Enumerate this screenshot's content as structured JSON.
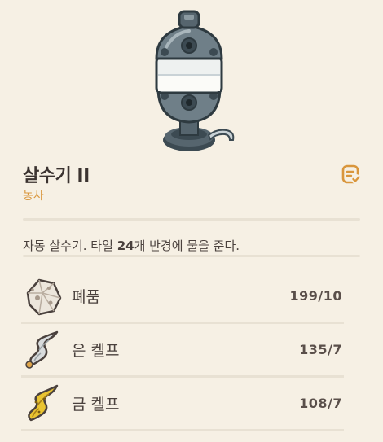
{
  "item": {
    "title": "살수기 II",
    "category": "농사",
    "description_prefix": "자동 살수기. 타일 ",
    "description_number": "24",
    "description_suffix": "개 반경에 물을 준다."
  },
  "ingredients": [
    {
      "name": "폐품",
      "count": "199/10",
      "icon": "refined-quartz-icon"
    },
    {
      "name": "은 켈프",
      "count": "135/7",
      "icon": "silver-kelp-icon"
    },
    {
      "name": "금 켈프",
      "count": "108/7",
      "icon": "gold-kelp-icon"
    }
  ],
  "colors": {
    "background": "#f6f0e4",
    "accent": "#d9963c",
    "text": "#3b3330",
    "divider": "#e8e1d3"
  },
  "icons": {
    "item": "sprinkler-icon",
    "recipe_button": "recipe-book-icon"
  }
}
